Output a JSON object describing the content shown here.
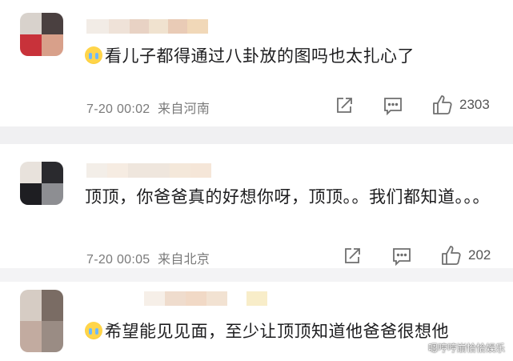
{
  "comments": [
    {
      "text": "看儿子都得通过八卦放的图吗也太扎心了",
      "has_emoji": true,
      "time": "7-20 00:02",
      "location": "来自河南",
      "likes": "2303",
      "avatar_colors": [
        "#d8d2cc",
        "#4a4040",
        "#c8323a",
        "#d8a08a"
      ],
      "name_colors": [
        "#f2ece6",
        "#efe2d8",
        "#e8d2c4",
        "#f0e2cf",
        "#e9cbb6",
        "#f1d8b8"
      ]
    },
    {
      "text": "顶顶，你爸爸真的好想你呀，顶顶。。我们都知道。。。",
      "has_emoji": false,
      "time": "7-20 00:05",
      "location": "来自北京",
      "likes": "202",
      "avatar_colors": [
        "#e8e2dc",
        "#2a2a2e",
        "#1e1e22",
        "#8d8e92"
      ],
      "name_colors": [
        "#f3eee8",
        "#f6ece2",
        "#efe6dd",
        "#f4e8da",
        "#f5e6d8"
      ]
    },
    {
      "text": "希望能见见面，至少让顶顶知道他爸爸很想他",
      "has_emoji": true,
      "avatar_colors": [
        "#d6ccc4",
        "#7a6c64",
        "#c2aba0",
        "#9a8c84"
      ],
      "name_colors": [
        "#f6efe8",
        "#efdccd",
        "#f1d9c6",
        "#f2e2d2",
        "#f8edc9"
      ]
    }
  ],
  "watermark": "嗯哼哼崩恰恰娱乐",
  "icons": [
    "share-icon",
    "comment-icon",
    "like-icon"
  ]
}
